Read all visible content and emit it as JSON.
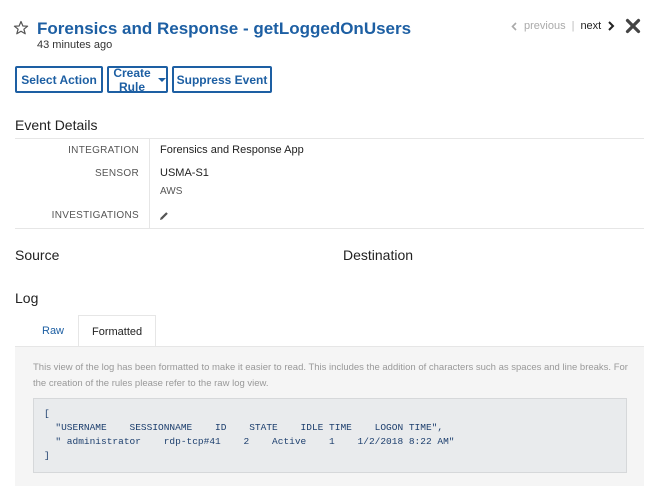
{
  "header": {
    "title": "Forensics and Response - getLoggedOnUsers",
    "time_ago": "43 minutes ago",
    "previous_label": "previous",
    "next_label": "next"
  },
  "actions": {
    "select_action": "Select Action",
    "create_rule": "Create Rule",
    "suppress_event": "Suppress Event"
  },
  "event_details": {
    "title": "Event Details",
    "rows": [
      {
        "label": "INTEGRATION",
        "value": "Forensics and Response App"
      },
      {
        "label": "SENSOR",
        "value": "USMA-S1",
        "sub": "AWS"
      },
      {
        "label": "INVESTIGATIONS"
      }
    ]
  },
  "source_title": "Source",
  "destination_title": "Destination",
  "log": {
    "title": "Log",
    "tabs": [
      {
        "label": "Raw",
        "active": false
      },
      {
        "label": "Formatted",
        "active": true
      }
    ],
    "note": "This view of the log has been formatted to make it easier to read. This includes the addition of characters such as spaces and line breaks. For the creation of the rules please refer to the raw log view.",
    "code_lines": [
      "[",
      "  \"USERNAME    SESSIONNAME    ID    STATE    IDLE TIME    LOGON TIME\",",
      "  \" administrator    rdp-tcp#41    2    Active    1    1/2/2018 8:22 AM\"",
      "]"
    ]
  },
  "colors": {
    "accent": "#1d5fa3",
    "panel": "#f5f5f5",
    "code_bg": "#e9ebed"
  }
}
